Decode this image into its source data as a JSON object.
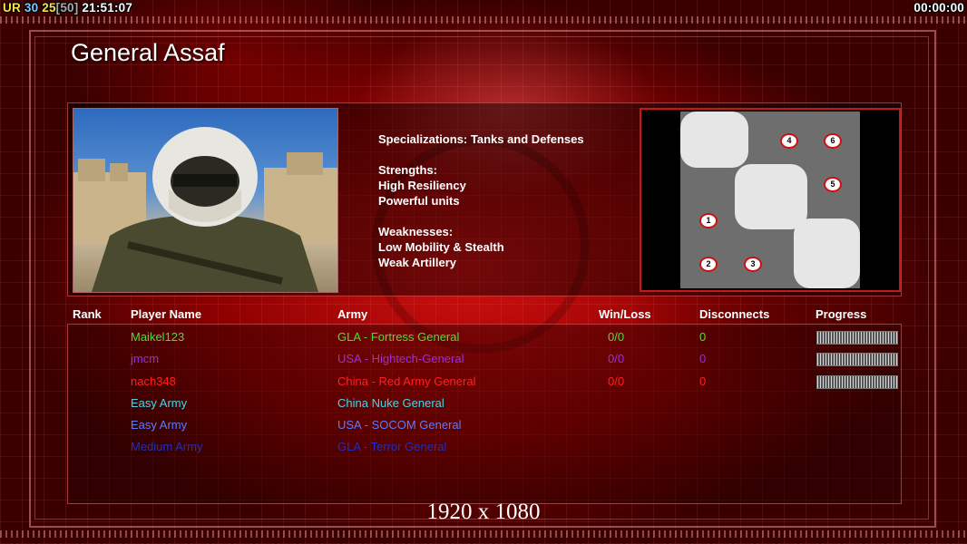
{
  "hud": {
    "ur_label": "UR",
    "fps": "30",
    "latency": "25",
    "bracket_value": "[50]",
    "clock": "21:51:07",
    "timer": "00:00:00"
  },
  "general": {
    "title": "General Assaf",
    "specialization": "Specializations: Tanks and Defenses",
    "strengths_header": "Strengths:",
    "strengths": [
      "High Resiliency",
      "Powerful units"
    ],
    "weaknesses_header": "Weaknesses:",
    "weaknesses": [
      "Low Mobility & Stealth",
      "Weak Artillery"
    ]
  },
  "map": {
    "start_positions": [
      "1",
      "2",
      "3",
      "4",
      "5",
      "6"
    ]
  },
  "table": {
    "headers": {
      "rank": "Rank",
      "player_name": "Player Name",
      "army": "Army",
      "win_loss": "Win/Loss",
      "disconnects": "Disconnects",
      "progress": "Progress"
    },
    "rows": [
      {
        "name": "Maikel123",
        "army": "GLA - Fortress General",
        "winloss": "0/0",
        "disconnects": "0",
        "color": "#4fdc3a",
        "has_progress": true
      },
      {
        "name": "jmcm",
        "army": "USA - Hightech-General",
        "winloss": "0/0",
        "disconnects": "0",
        "color": "#9a2ee0",
        "has_progress": true
      },
      {
        "name": "nach348",
        "army": "China - Red Army General",
        "winloss": "0/0",
        "disconnects": "0",
        "color": "#ff2020",
        "has_progress": true
      },
      {
        "name": "Easy Army",
        "army": "China Nuke General",
        "winloss": "",
        "disconnects": "",
        "color": "#46d6e6",
        "has_progress": false
      },
      {
        "name": "Easy Army",
        "army": "USA - SOCOM General",
        "winloss": "",
        "disconnects": "",
        "color": "#5a7cff",
        "has_progress": false
      },
      {
        "name": "Medium Army",
        "army": "GLA - Terror General",
        "winloss": "",
        "disconnects": "",
        "color": "#1f2fc0",
        "has_progress": false
      }
    ]
  },
  "footer": {
    "resolution": "1920 x 1080"
  }
}
